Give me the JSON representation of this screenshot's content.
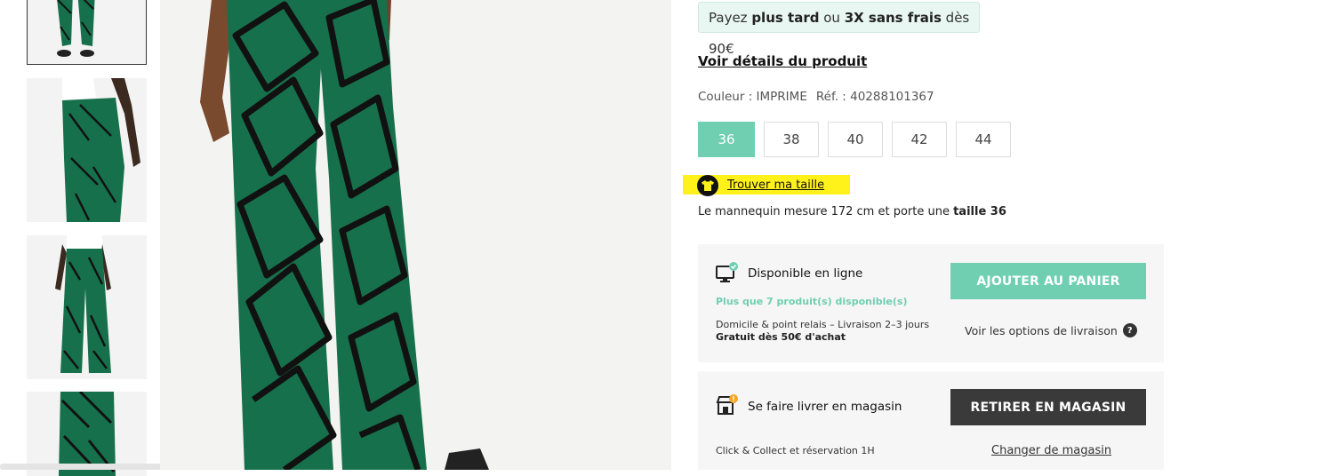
{
  "gallery": {
    "thumbnails": [
      "front-view",
      "side-view",
      "back-view",
      "detail-view"
    ],
    "selected_index": 0
  },
  "product": {
    "pay_later": {
      "prefix": "Payez ",
      "bold1": "plus tard",
      "mid": " ou ",
      "bold2": "3X sans frais",
      "suffix": " dès 90€"
    },
    "details_link": "Voir détails du produit",
    "color_label": "Couleur : IMPRIME",
    "ref_label": "Réf. : 40288101367",
    "sizes": [
      "36",
      "38",
      "40",
      "42",
      "44"
    ],
    "selected_size": "36",
    "find_size": "Trouver ma taille",
    "model_info_prefix": "Le mannequin mesure 172 cm et porte une ",
    "model_info_bold": "taille 36"
  },
  "online": {
    "title": "Disponible en ligne",
    "stock": "Plus que 7 produit(s) disponible(s)",
    "delivery_line1": "Domicile & point relais – Livraison 2–3 jours",
    "delivery_line2": "Gratuit dès 50€ d'achat",
    "add_button": "AJOUTER AU PANIER",
    "options_link": "Voir les options de livraison",
    "help_icon": "?"
  },
  "store": {
    "title": "Se faire livrer en magasin",
    "button": "RETIRER EN MAGASIN",
    "info": "Click & Collect et réservation 1H",
    "change_link": "Changer de magasin"
  },
  "colors": {
    "accent": "#6fcfb0",
    "highlight": "#fff21b",
    "dark_button": "#3a3a3a",
    "fabric_green": "#17704c"
  }
}
